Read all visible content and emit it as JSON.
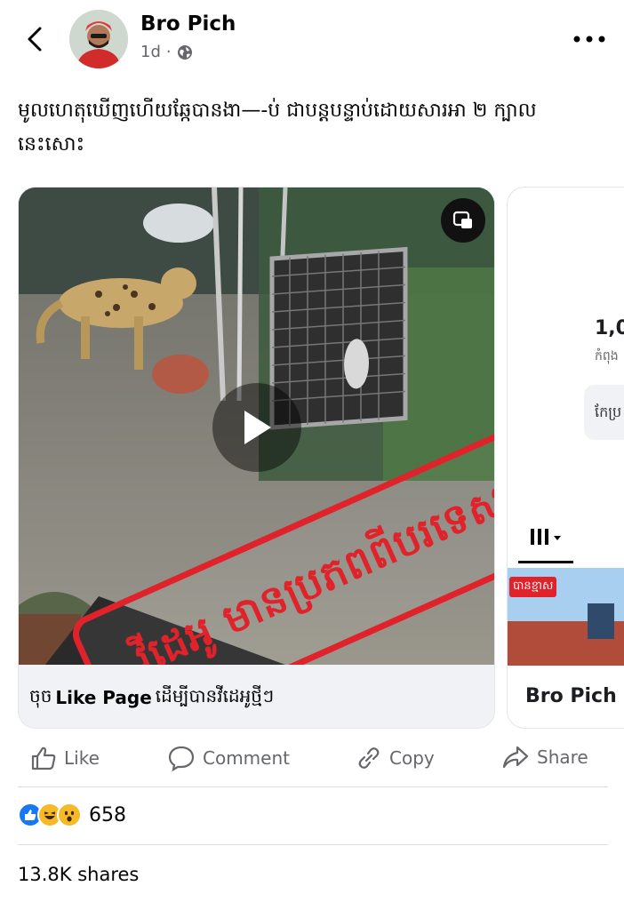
{
  "header": {
    "author": "Bro Pich",
    "time": "1d",
    "separator": "·",
    "privacy_icon": "globe-icon",
    "back_icon": "chevron-left-icon",
    "more_icon": "more-horizontal-icon"
  },
  "post": {
    "caption": "មូលហេតុឃើញហើយឆ្កែបានងា—-ប់ ជាបន្តបន្ទាប់ដោយសារអា ២ ក្បាល នេះសោះ"
  },
  "video_card": {
    "overlay_stamp": "វីដេអូ មានប្រភពពីបរទេស",
    "footer_prefix": "ចុច",
    "footer_link": "Like Page",
    "footer_suffix": "ដើម្បីបានវីដេអូថ្មីៗ",
    "pip_icon": "picture-in-picture-icon",
    "play_icon": "play-icon"
  },
  "side_card": {
    "number": "1,0",
    "subtext": "កំពុង",
    "pill_text": "កែប្រ",
    "thumb_badge": "បានខ្មាស",
    "footer_name": "Bro Pich"
  },
  "actions": {
    "like": "Like",
    "comment": "Comment",
    "copy": "Copy",
    "share": "Share"
  },
  "engagement": {
    "reaction_count": "658",
    "shares": "13.8K shares"
  },
  "colors": {
    "stamp_red": "#e0222b",
    "like_blue": "#1877f2",
    "reaction_yellow": "#f7b928",
    "secondary_text": "#65676b"
  }
}
